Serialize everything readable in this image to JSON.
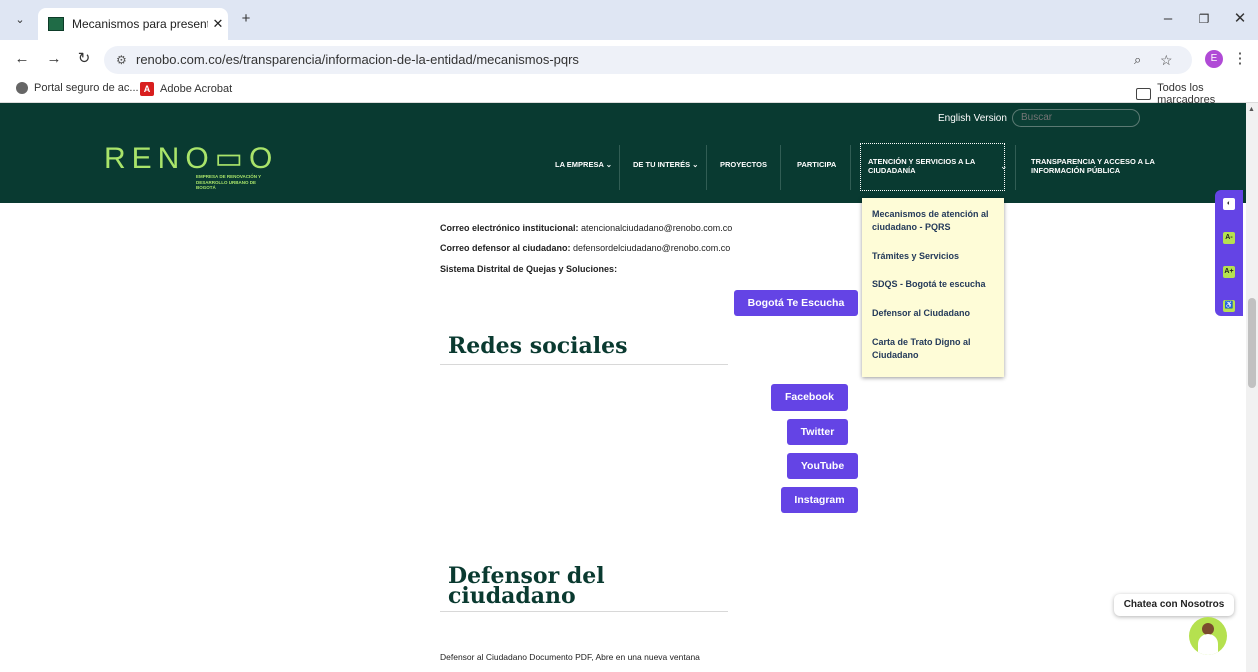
{
  "browser": {
    "tab_title": "Mecanismos para presentar Pet",
    "tab_close": "✕",
    "new_tab": "+",
    "url": "renobo.com.co/es/transparencia/informacion-de-la-entidad/mecanismos-pqrs",
    "profile_initial": "E",
    "bookmarks": [
      "Portal seguro de ac...",
      "Adobe Acrobat"
    ],
    "all_bookmarks": "Todos los marcadores",
    "pdf_glyph": "A"
  },
  "header": {
    "logo": "RENO▭O",
    "logo_sub": "EMPRESA DE RENOVACIÓN Y DESARROLLO URBANO DE BOGOTÁ",
    "english_version": "English Version",
    "search_placeholder": "Buscar",
    "nav": {
      "empresa": "LA EMPRESA ⌄",
      "interes": "DE TU INTERÉS ⌄",
      "proyectos": "PROYECTOS",
      "participa": "PARTICIPA",
      "atencion": "ATENCIÓN Y SERVICIOS A LA CIUDADANÍA",
      "transparencia": "TRANSPARENCIA Y ACCESO A LA INFORMACIÓN PÚBLICA"
    }
  },
  "dropdown": {
    "items": [
      "Mecanismos de atención al ciudadano - PQRS",
      "Trámites y Servicios",
      "SDQS - Bogotá te escucha",
      "Defensor al Ciudadano",
      "Carta de Trato Digno al Ciudadano"
    ]
  },
  "content": {
    "email_label": "Correo electrónico institucional:",
    "email_value": "atencionalciudadano@renobo.com.co",
    "defensor_label": "Correo defensor al ciudadano:",
    "defensor_value": "defensordelciudadano@renobo.com.co",
    "sdqs_label": "Sistema Distrital de Quejas y Soluciones:",
    "bogota_button": "Bogotá Te Escucha",
    "redes_heading": "Redes sociales",
    "social": [
      "Facebook",
      "Twitter",
      "YouTube",
      "Instagram"
    ],
    "defensor_heading_1": "Defensor del",
    "defensor_heading_2": "ciudadano",
    "defensor_doc": "Defensor al Ciudadano Documento PDF, Abre en una nueva ventana"
  },
  "chat": {
    "label": "Chatea con Nosotros"
  }
}
